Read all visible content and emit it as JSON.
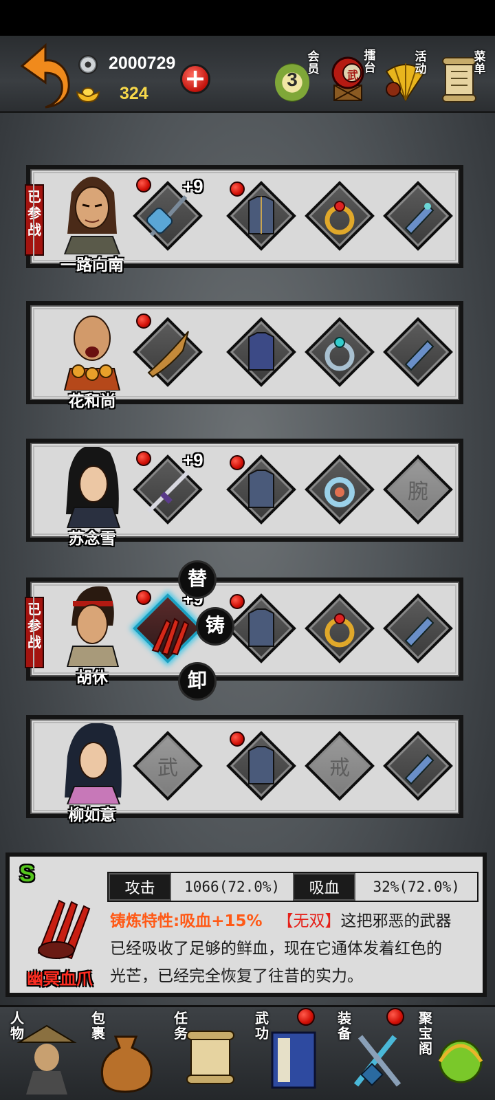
{
  "currency": {
    "silver": "2000729",
    "gold": "324",
    "add_label": "+"
  },
  "top_menu": {
    "vip_level": "3",
    "vip_label": "会员",
    "arena_label": "擂台",
    "arena_badge": "武",
    "events_label": "活动",
    "menu_label": "菜单"
  },
  "heroes": [
    {
      "name": "一路向南",
      "status": "已参战",
      "weapon_plus": "+9"
    },
    {
      "name": "花和尚"
    },
    {
      "name": "苏念雪",
      "weapon_plus": "+9",
      "wrist_placeholder": "腕"
    },
    {
      "name": "胡休",
      "status": "已参战",
      "weapon_plus": "+9"
    },
    {
      "name": "柳如意",
      "weapon_placeholder": "武",
      "ring_placeholder": "戒"
    }
  ],
  "item_actions": {
    "replace": "替",
    "forge": "铸",
    "unequip": "卸"
  },
  "item_detail": {
    "grade": "S",
    "name": "幽冥血爪",
    "stat1_label": "攻击",
    "stat1_value": "1066(72.0%)",
    "stat2_label": "吸血",
    "stat2_value": "32%(72.0%)",
    "forge_trait": "铸炼特性:吸血+15%",
    "tag": "【无双】",
    "description_1": "这把邪恶的武器",
    "description_2": "已经吸收了足够的鲜血，现在它通体发着红色的",
    "description_3": "光芒，已经完全恢复了往昔的实力。"
  },
  "bottom_nav": {
    "character": "人物",
    "bag": "包裹",
    "quests": "任务",
    "martial": "武功",
    "equipment": "装备",
    "treasure": "聚宝阁"
  },
  "colors": {
    "accent_red": "#d10f06",
    "grade_green": "#55c61d",
    "item_name_red": "#ff2d22",
    "gold_text": "#f7d84a"
  }
}
